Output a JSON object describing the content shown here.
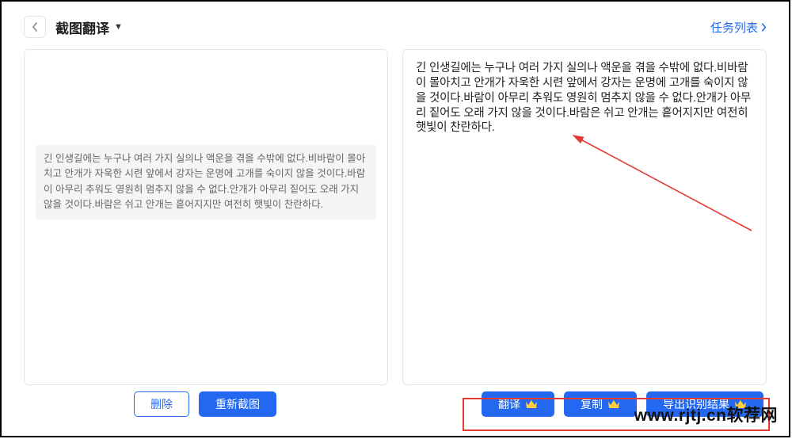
{
  "header": {
    "title": "截图翻译",
    "task_list_label": "任务列表"
  },
  "source": {
    "ocr_text": "긴 인생길에는 누구나 여러 가지 실의나 액운을 겪을 수밖에 없다.비바람이 몰아치고 안개가 자욱한 시련 앞에서 강자는 운명에 고개를 숙이지 않을 것이다.바람이 아무리 추워도 영원히 멈추지 않을 수 없다.안개가 아무리 짙어도 오래 가지 않을 것이다.바람은 쉬고 안개는 흩어지지만 여전히 햇빛이 찬란하다."
  },
  "output": {
    "text": "긴 인생길에는 누구나 여러 가지 실의나 액운을 겪을 수밖에 없다.비바람이 몰아치고 안개가 자욱한 시련 앞에서 강자는 운명에 고개를 숙이지 않을 것이다.바람이 아무리 추워도 영원히 멈추지 않을 수 없다.안개가 아무리 짙어도 오래 가지 않을 것이다.바람은 쉬고 안개는 흩어지지만 여전히 햇빛이 찬란하다."
  },
  "buttons": {
    "delete": "删除",
    "recapture": "重新截图",
    "translate": "翻译",
    "copy": "复制",
    "export": "导出识别结果"
  },
  "watermark": "www.rjtj.cn软荐网"
}
